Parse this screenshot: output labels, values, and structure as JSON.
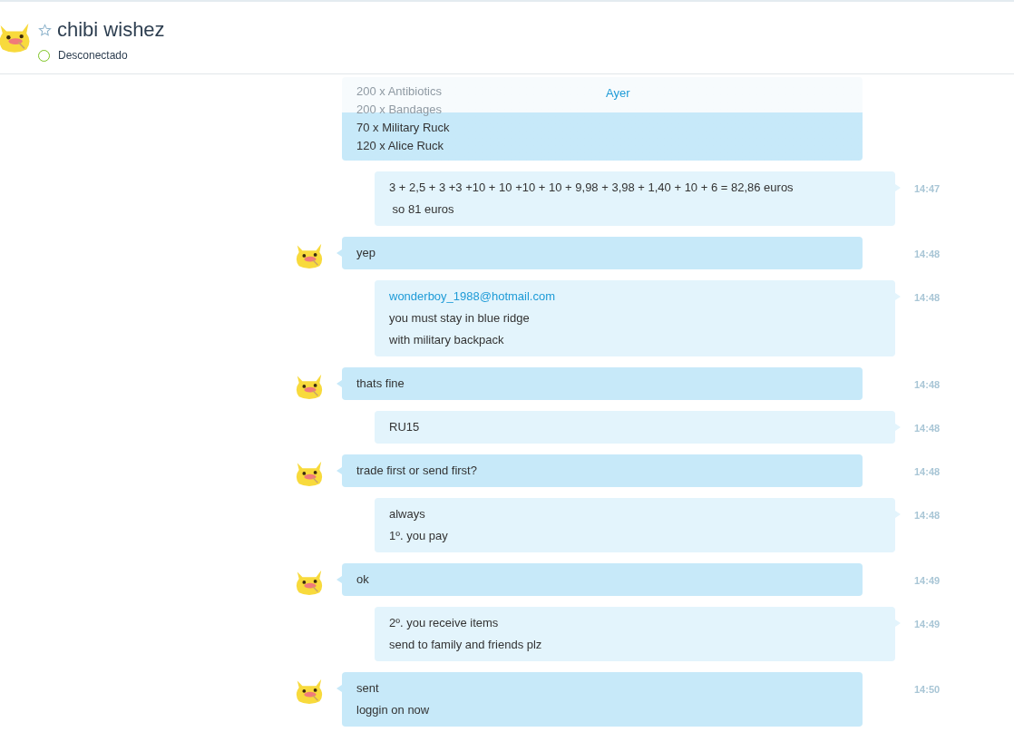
{
  "contact": {
    "name": "chibi wishez",
    "favorite": false,
    "status": "Desconectado"
  },
  "date_divider": "Ayer",
  "messages": [
    {
      "kind": "them",
      "avatar": false,
      "faded_lines": [
        "200 x Antibiotics",
        "200 x Bandages"
      ],
      "lines": [
        "70 x Military Ruck",
        "120 x Alice Ruck"
      ]
    },
    {
      "kind": "me",
      "time": "14:47",
      "lines": [
        "3 + 2,5 + 3 +3 +10 + 10 +10 + 10 + 9,98 + 3,98 + 1,40 + 10 + 6 = 82,86 euros",
        " so 81 euros"
      ]
    },
    {
      "kind": "them",
      "avatar": true,
      "time": "14:48",
      "lines": [
        "yep"
      ]
    },
    {
      "kind": "me",
      "time": "14:48",
      "link": "wonderboy_1988@hotmail.com",
      "lines": [
        "you must stay in blue ridge",
        "with military backpack"
      ]
    },
    {
      "kind": "them",
      "avatar": true,
      "time": "14:48",
      "lines": [
        "thats fine"
      ]
    },
    {
      "kind": "me",
      "time": "14:48",
      "lines": [
        "RU15"
      ]
    },
    {
      "kind": "them",
      "avatar": true,
      "time": "14:48",
      "lines": [
        "trade first or send first?"
      ]
    },
    {
      "kind": "me",
      "time": "14:48",
      "lines": [
        "always",
        "1º. you pay"
      ]
    },
    {
      "kind": "them",
      "avatar": true,
      "time": "14:49",
      "lines": [
        "ok"
      ]
    },
    {
      "kind": "me",
      "time": "14:49",
      "lines": [
        "2º. you receive items",
        "send to family and friends plz"
      ]
    },
    {
      "kind": "them",
      "avatar": true,
      "time": "14:50",
      "lines": [
        "sent",
        "loggin on now"
      ]
    }
  ]
}
